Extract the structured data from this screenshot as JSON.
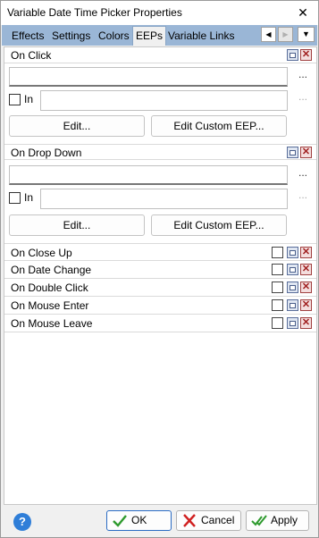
{
  "window": {
    "title": "Variable Date Time Picker Properties",
    "close_glyph": "✕"
  },
  "tabs": [
    {
      "label": "Effects",
      "active": false
    },
    {
      "label": "Settings",
      "active": false
    },
    {
      "label": "Colors",
      "active": false
    },
    {
      "label": "EEPs",
      "active": true
    },
    {
      "label": "Variable Links",
      "active": false
    }
  ],
  "tab_nav": {
    "left_glyph": "◀",
    "right_glyph": "▶",
    "dropdown_glyph": "▼"
  },
  "sections": [
    {
      "label": "On Click",
      "expanded": true,
      "command_value": "",
      "in_label": "In",
      "in_checked": false,
      "in_value": "",
      "edit_label": "Edit...",
      "edit_custom_label": "Edit Custom EEP..."
    },
    {
      "label": "On Drop Down",
      "expanded": true,
      "command_value": "",
      "in_label": "In",
      "in_checked": false,
      "in_value": "",
      "edit_label": "Edit...",
      "edit_custom_label": "Edit Custom EEP..."
    }
  ],
  "events": [
    {
      "label": "On Close Up"
    },
    {
      "label": "On Date Change"
    },
    {
      "label": "On Double Click"
    },
    {
      "label": "On Mouse Enter"
    },
    {
      "label": "On Mouse Leave"
    }
  ],
  "glyphs": {
    "ellipsis": "...",
    "delete": "✕",
    "help": "?"
  },
  "footer": {
    "ok_label": "OK",
    "cancel_label": "Cancel",
    "apply_label": "Apply"
  },
  "colors": {
    "tab_strip": "#9ab6d6",
    "help_blue": "#2f7ed8",
    "ok_green": "#2e9a2e",
    "cancel_red": "#d02020"
  }
}
